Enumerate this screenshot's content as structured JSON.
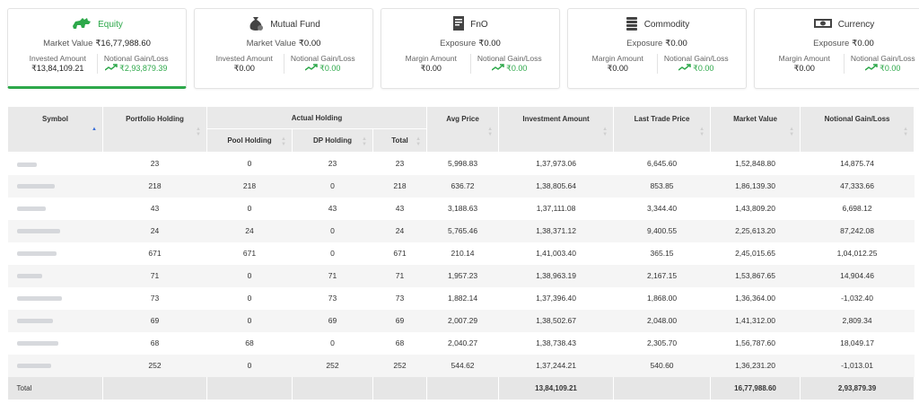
{
  "cards": [
    {
      "title": "Equity",
      "icon": "bull-icon",
      "main_label": "Market Value",
      "main_value": "₹16,77,988.60",
      "left_label": "Invested Amount",
      "left_value": "₹13,84,109.21",
      "right_label": "Notional Gain/Loss",
      "right_value": "₹2,93,879.39",
      "active": true
    },
    {
      "title": "Mutual Fund",
      "icon": "money-bag-icon",
      "main_label": "Market Value",
      "main_value": "₹0.00",
      "left_label": "Invested Amount",
      "left_value": "₹0.00",
      "right_label": "Notional Gain/Loss",
      "right_value": "₹0.00"
    },
    {
      "title": "FnO",
      "icon": "document-icon",
      "main_label": "Exposure",
      "main_value": "₹0.00",
      "left_label": "Margin Amount",
      "left_value": "₹0.00",
      "right_label": "Notional Gain/Loss",
      "right_value": "₹0.00"
    },
    {
      "title": "Commodity",
      "icon": "coin-stack-icon",
      "main_label": "Exposure",
      "main_value": "₹0.00",
      "left_label": "Margin Amount",
      "left_value": "₹0.00",
      "right_label": "Notional Gain/Loss",
      "right_value": "₹0.00"
    },
    {
      "title": "Currency",
      "icon": "banknote-icon",
      "main_label": "Exposure",
      "main_value": "₹0.00",
      "left_label": "Margin Amount",
      "left_value": "₹0.00",
      "right_label": "Notional Gain/Loss",
      "right_value": "₹0.00"
    }
  ],
  "table": {
    "headers": {
      "symbol": "Symbol",
      "portfolio_holding": "Portfolio Holding",
      "actual_holding": "Actual Holding",
      "pool_holding": "Pool Holding",
      "dp_holding": "DP Holding",
      "total": "Total",
      "avg_price": "Avg Price",
      "investment_amount": "Investment Amount",
      "last_trade_price": "Last Trade Price",
      "market_value": "Market Value",
      "notional_gain_loss": "Notional Gain/Loss"
    },
    "rows": [
      [
        "23",
        "0",
        "23",
        "23",
        "5,998.83",
        "1,37,973.06",
        "6,645.60",
        "1,52,848.80",
        "14,875.74"
      ],
      [
        "218",
        "218",
        "0",
        "218",
        "636.72",
        "1,38,805.64",
        "853.85",
        "1,86,139.30",
        "47,333.66"
      ],
      [
        "43",
        "0",
        "43",
        "43",
        "3,188.63",
        "1,37,111.08",
        "3,344.40",
        "1,43,809.20",
        "6,698.12"
      ],
      [
        "24",
        "24",
        "0",
        "24",
        "5,765.46",
        "1,38,371.12",
        "9,400.55",
        "2,25,613.20",
        "87,242.08"
      ],
      [
        "671",
        "671",
        "0",
        "671",
        "210.14",
        "1,41,003.40",
        "365.15",
        "2,45,015.65",
        "1,04,012.25"
      ],
      [
        "71",
        "0",
        "71",
        "71",
        "1,957.23",
        "1,38,963.19",
        "2,167.15",
        "1,53,867.65",
        "14,904.46"
      ],
      [
        "73",
        "0",
        "73",
        "73",
        "1,882.14",
        "1,37,396.40",
        "1,868.00",
        "1,36,364.00",
        "-1,032.40"
      ],
      [
        "69",
        "0",
        "69",
        "69",
        "2,007.29",
        "1,38,502.67",
        "2,048.00",
        "1,41,312.00",
        "2,809.34"
      ],
      [
        "68",
        "68",
        "0",
        "68",
        "2,040.27",
        "1,38,738.43",
        "2,305.70",
        "1,56,787.60",
        "18,049.17"
      ],
      [
        "252",
        "0",
        "252",
        "252",
        "544.62",
        "1,37,244.21",
        "540.60",
        "1,36,231.20",
        "-1,013.01"
      ]
    ],
    "footer": {
      "label": "Total",
      "investment_amount": "13,84,109.21",
      "market_value": "16,77,988.60",
      "notional_gain_loss": "2,93,879.39"
    }
  },
  "colors": {
    "accent": "#2da84a",
    "sort_active": "#3b6fd8"
  }
}
